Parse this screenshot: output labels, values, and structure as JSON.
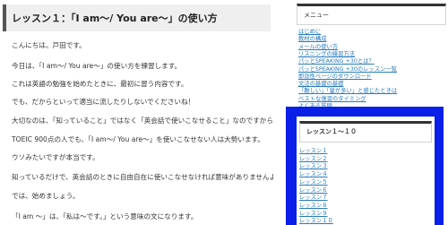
{
  "article": {
    "title": "レッスン１：「I am～/ You are～」の使い方",
    "paragraphs": [
      "こんにちは。戸田です。",
      "今日は、「I am～/ You are～」の使い方を練習します。",
      "これは英語の勉強を始めたときに、最初に習う内容です。",
      "でも、だからといって適当に流したりしないでくださいね！",
      "大切なのは、「知っていること」ではなく「英会話で使いこなせること」なのですから。",
      "TOEIC 900点の人でも、「I am～/ You are～」を使いこなせない人は大勢います。",
      "ウソみたいですが本当です。",
      "知っているだけで、英会話のときに自由自在に使いこなせなければ意味がありませんよね。",
      "では、始めましょう。",
      "「I am ～」は、「私は～です。」という意味の文になります。"
    ]
  },
  "sidebar": {
    "menu_heading": "メニュー",
    "menu_items": [
      "はじめに",
      "教材の構成",
      "メールの使い方",
      "リスニングの練習方法",
      "パッとSPEAKING +30とは？",
      "パッとSPEAKING +30のレッスン一覧",
      "即効性ページのダウンロード",
      "文法の基礎の基礎",
      "「難しい」「量が多い」と感じたときは",
      "ベストな復習のタイミング",
      "よくある質問"
    ],
    "lessons_heading": "レッスン１～１０",
    "lessons": [
      "レッスン１",
      "レッスン２",
      "レッスン３",
      "レッスン４",
      "レッスン５",
      "レッスン６",
      "レッスン７",
      "レッスン８",
      "レッスン９",
      "レッスン１０"
    ]
  },
  "colors": {
    "highlight_frame": "#0a1fe8",
    "link": "#2a7bbf",
    "title_bar_bg": "#efefef"
  }
}
